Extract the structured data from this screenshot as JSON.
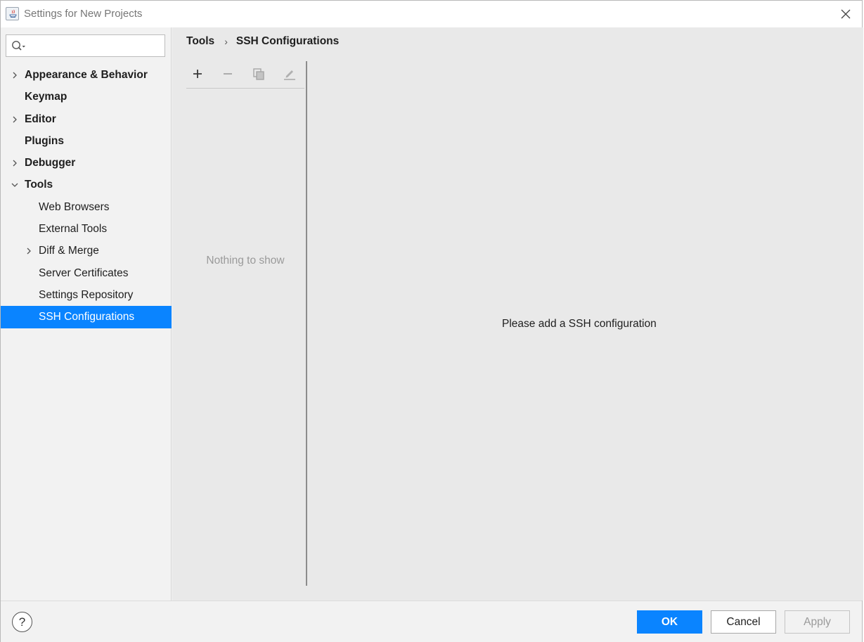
{
  "window": {
    "title": "Settings for New Projects"
  },
  "search": {
    "value": "",
    "placeholder": ""
  },
  "sidebar": {
    "items": [
      {
        "label": "Appearance & Behavior",
        "level": 0,
        "expandable": true,
        "expanded": false
      },
      {
        "label": "Keymap",
        "level": 0,
        "expandable": false
      },
      {
        "label": "Editor",
        "level": 0,
        "expandable": true,
        "expanded": false
      },
      {
        "label": "Plugins",
        "level": 0,
        "expandable": false
      },
      {
        "label": "Debugger",
        "level": 0,
        "expandable": true,
        "expanded": false
      },
      {
        "label": "Tools",
        "level": 0,
        "expandable": true,
        "expanded": true
      },
      {
        "label": "Web Browsers",
        "level": 1,
        "expandable": false
      },
      {
        "label": "External Tools",
        "level": 1,
        "expandable": false
      },
      {
        "label": "Diff & Merge",
        "level": 1,
        "expandable": true,
        "expanded": false
      },
      {
        "label": "Server Certificates",
        "level": 1,
        "expandable": false
      },
      {
        "label": "Settings Repository",
        "level": 1,
        "expandable": false
      },
      {
        "label": "SSH Configurations",
        "level": 1,
        "expandable": false,
        "selected": true
      }
    ]
  },
  "breadcrumb": {
    "parent": "Tools",
    "separator": "›",
    "current": "SSH Configurations"
  },
  "toolbar": {
    "icons": [
      "add-icon",
      "remove-icon",
      "copy-icon",
      "edit-icon"
    ]
  },
  "list": {
    "empty_text": "Nothing to show"
  },
  "detail": {
    "message": "Please add a SSH configuration"
  },
  "footer": {
    "help_label": "?",
    "ok_label": "OK",
    "cancel_label": "Cancel",
    "apply_label": "Apply"
  },
  "colors": {
    "accent": "#0a84ff",
    "sidebar_bg": "#f2f2f2",
    "content_bg": "#e9e9e9",
    "disabled_text": "#9a9a9a"
  }
}
